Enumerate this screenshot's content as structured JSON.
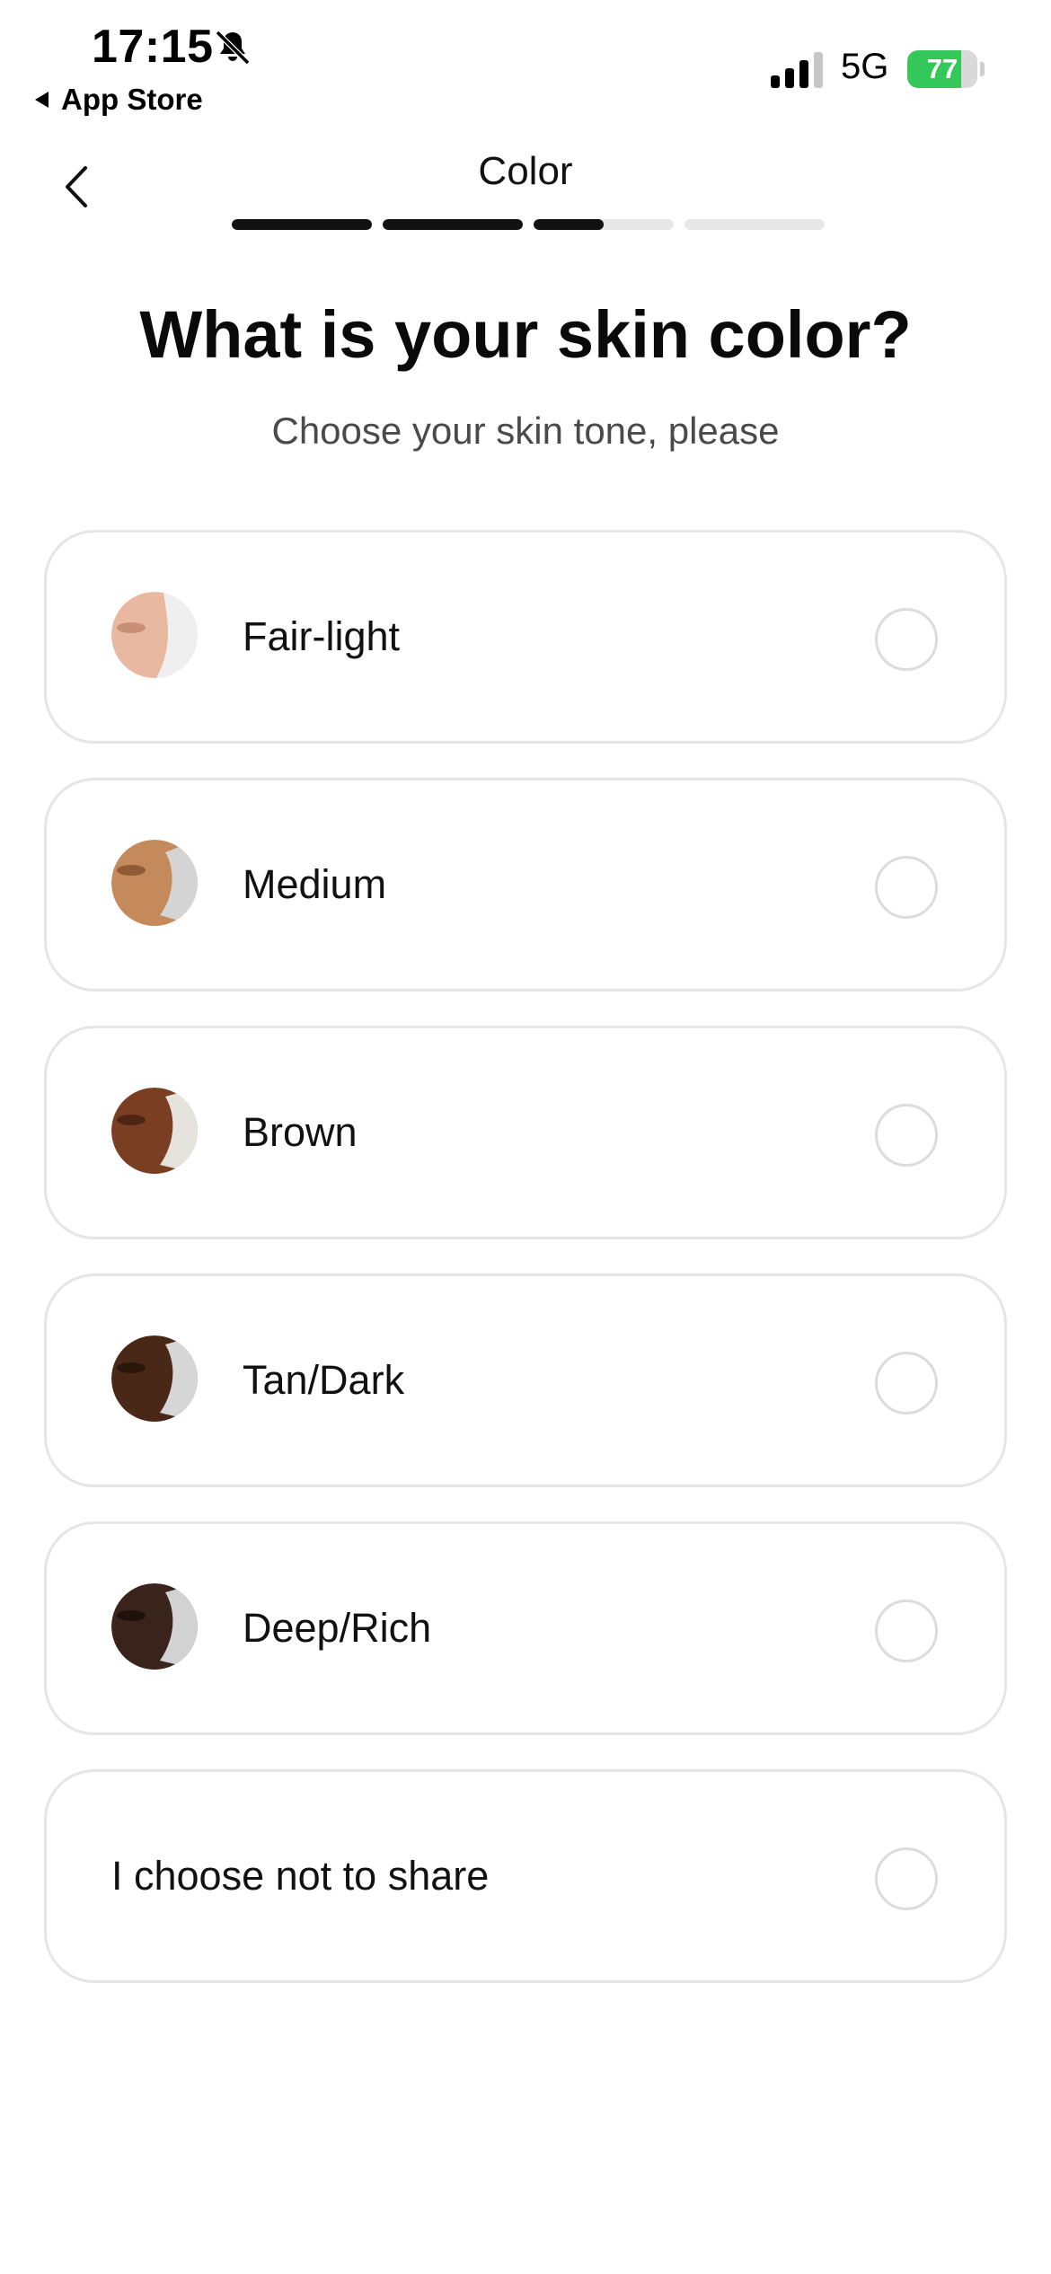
{
  "status_bar": {
    "time": "17:15",
    "back_app": "App Store",
    "network": "5G",
    "battery_level": "77",
    "battery_fraction": 0.77,
    "battery_color": "#34c759",
    "icons": [
      "bell-slash-icon",
      "signal-icon",
      "battery-charging-icon"
    ]
  },
  "header": {
    "title": "Color",
    "back_icon": "chevron-left-icon",
    "progress_segments": [
      1,
      1,
      0.5,
      0
    ]
  },
  "question": {
    "title": "What is your skin color?",
    "subtitle": "Choose your skin tone, please"
  },
  "options": [
    {
      "label": "Fair-light",
      "selected": false,
      "skin": "#e8b9a0",
      "shade": "#c98f76"
    },
    {
      "label": "Medium",
      "selected": false,
      "skin": "#c48a5c",
      "shade": "#8f5a35"
    },
    {
      "label": "Brown",
      "selected": false,
      "skin": "#7a3f22",
      "shade": "#4e2412"
    },
    {
      "label": "Tan/Dark",
      "selected": false,
      "skin": "#4a2818",
      "shade": "#2b160c"
    },
    {
      "label": "Deep/Rich",
      "selected": false,
      "skin": "#3a231b",
      "shade": "#1f120d"
    },
    {
      "label": "I choose not to share",
      "selected": false
    }
  ]
}
